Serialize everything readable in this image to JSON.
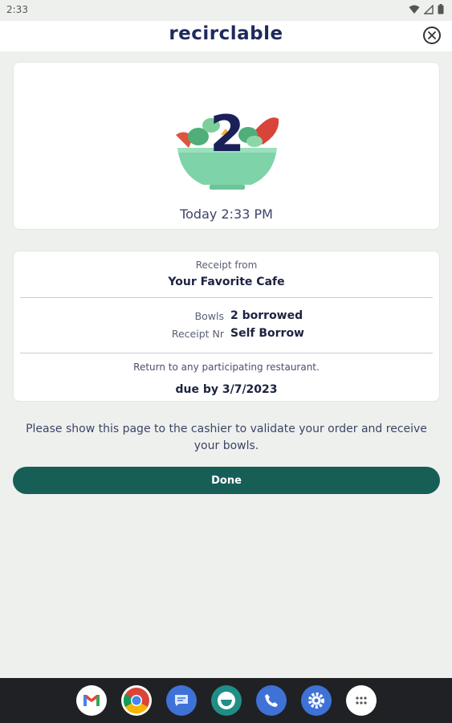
{
  "status_bar": {
    "time": "2:33"
  },
  "header": {
    "logo_text": "recirclable"
  },
  "summary": {
    "bowl_count": "2",
    "timestamp": "Today 2:33 PM"
  },
  "receipt": {
    "from_label": "Receipt from",
    "restaurant": "Your Favorite Cafe",
    "bowls_label": "Bowls",
    "bowls_value": "2 borrowed",
    "receipt_nr_label": "Receipt Nr",
    "receipt_nr_value": "Self Borrow",
    "return_note": "Return to any participating restaurant.",
    "due": "due by 3/7/2023"
  },
  "instruction": "Please show this page to the cashier to validate your order and receive your bowls.",
  "done_label": "Done",
  "colors": {
    "brand_navy": "#1b2158",
    "accent_green": "#175e57",
    "bowl_green": "#7ed3a8"
  },
  "dock_icons": [
    "gmail-icon",
    "chrome-icon",
    "messages-icon",
    "recirclable-app-icon",
    "phone-icon",
    "settings-icon",
    "app-drawer-icon"
  ]
}
